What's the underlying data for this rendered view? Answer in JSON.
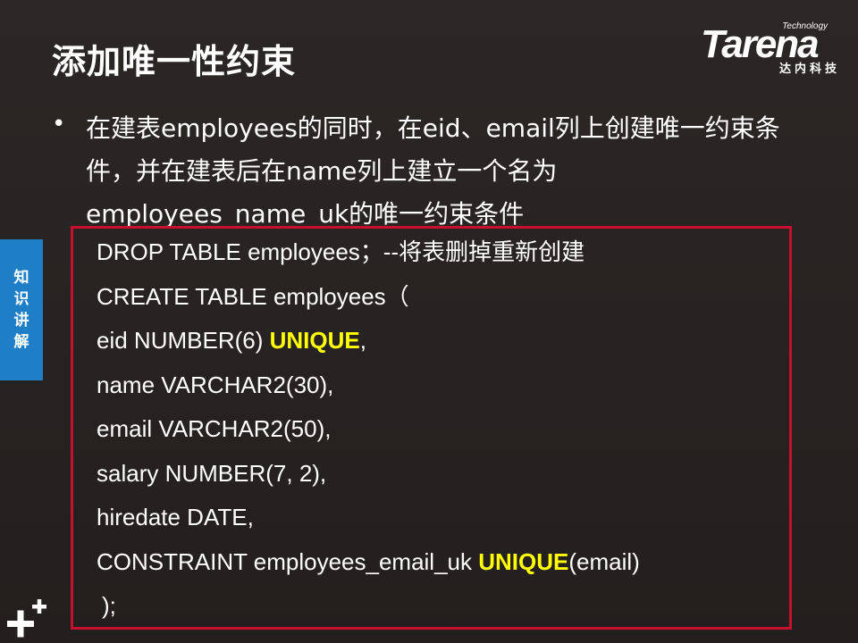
{
  "slide": {
    "title": "添加唯一性约束",
    "logo": {
      "tagline": "Technology",
      "wordmark": "Tarena",
      "chinese": "达内科技"
    },
    "side_tab": [
      "知",
      "识",
      "讲",
      "解"
    ],
    "bullet": "在建表employees的同时，在eid、email列上创建唯一约束条件，并在建表后在name列上建立一个名为employees_name_uk的唯一约束条件",
    "code": {
      "line1": "DROP TABLE employees；--将表删掉重新创建",
      "line2": "CREATE TABLE employees（",
      "line3_pre": "eid NUMBER(6) ",
      "line3_kw": "UNIQUE",
      "line3_post": ",",
      "line4": "name VARCHAR2(30),",
      "line5": "email VARCHAR2(50),",
      "line6": "salary NUMBER(7, 2),",
      "line7": "hiredate DATE,",
      "line8_pre": "CONSTRAINT employees_email_uk ",
      "line8_kw": "UNIQUE",
      "line8_post": "(email)",
      "line9": ");"
    },
    "colors": {
      "background": "#262322",
      "accent_blue": "#1f7fc6",
      "box_border": "#c8102e",
      "keyword": "#ffff00"
    },
    "icons": {
      "side_tab": "vertical-label",
      "bottom_left": "plus-plus-icon"
    }
  }
}
